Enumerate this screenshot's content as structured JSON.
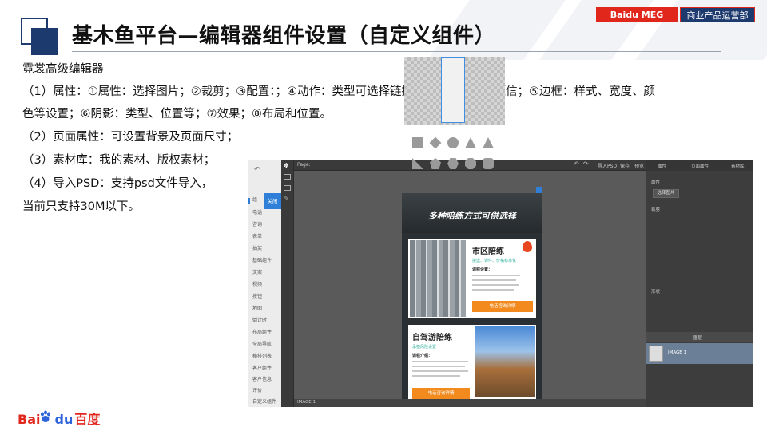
{
  "header": {
    "title": "基木鱼平台—编辑器组件设置（自定义组件）",
    "tag_meg": "Baidu MEG",
    "tag_dept": "商业产品运营部"
  },
  "content": {
    "heading": "霓裳高级编辑器",
    "lines": [
      "（1）属性：①属性：选择图片；②裁剪；③配置：；④动作：类型可选择链接、电话、下载、短信；⑤边框：样式、宽度、颜",
      "色等设置；⑥阴影：类型、位置等；⑦效果；⑧布局和位置。",
      "（2）页面属性：可设置背景及页面尺寸；",
      "（3）素材库：我的素材、版权素材；",
      "（4）导入PSD：支持psd文件导入，",
      "当前只支持30M以下。"
    ]
  },
  "editor": {
    "close_label": "关闭",
    "left_items": [
      "组",
      "电话",
      "咨询",
      "表单",
      "抽奖",
      "基础组件",
      "文案",
      "视频",
      "按钮",
      "地图",
      "倒计时",
      "布局组件",
      "全局导航",
      "横排列表",
      "客户组件",
      "客户信息",
      "评价",
      "自定义组件"
    ],
    "top_left": "Page:",
    "top_import": "导入PSD",
    "top_save": "保存",
    "top_preview": "预览",
    "status": "IMAGE 1",
    "right_tabs": [
      "属性",
      "页面属性",
      "素材库"
    ],
    "sec_property": "属性",
    "btn_select_image": "选择图片",
    "sec_crop": "裁剪",
    "sec_shape": "形状",
    "layer_header": "图层",
    "layer_name": "IMAGE 1",
    "poster": {
      "headline": "多种陪练方式可供选择",
      "card1_title": "市区陪练",
      "card1_sub": "接送、课件、价格标准化",
      "card1_label": "课程设置：",
      "card1_btn": "电话咨询详情",
      "card2_title": "自驾游陪练",
      "card2_sub": "承担风险设置",
      "card2_label": "课程介绍：",
      "card2_btn": "电话咨询详情"
    }
  },
  "footer": {
    "logo_bai": "Bai",
    "logo_du": "du",
    "logo_cn": "百度"
  }
}
